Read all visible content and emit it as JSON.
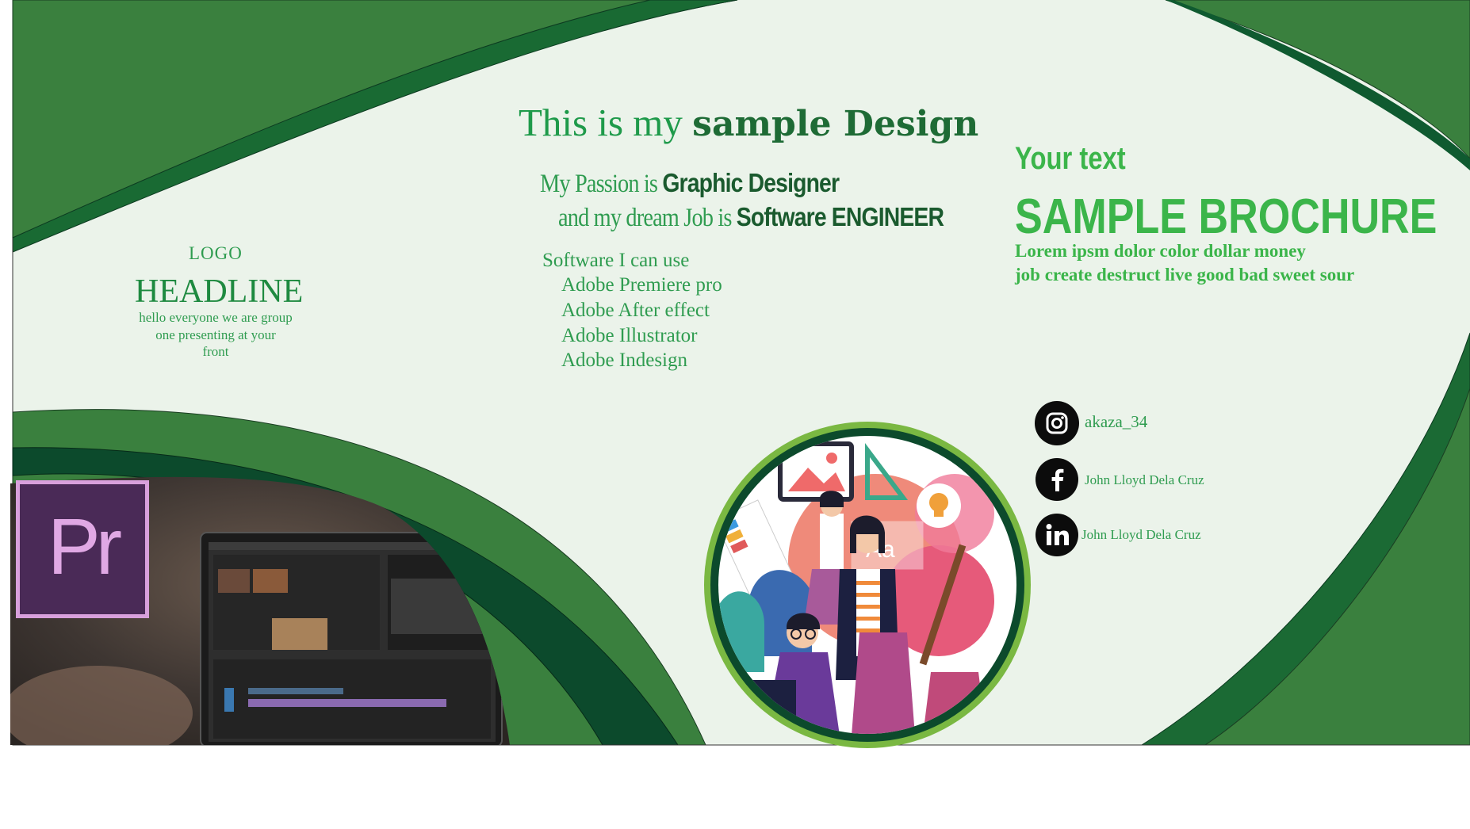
{
  "title": {
    "light": "This is my ",
    "bold": "sample Design"
  },
  "passion": {
    "line1_light": "My Passion is ",
    "line1_bold": "Graphic Designer",
    "line2_light": "and my dream Job is ",
    "line2_bold": "Software ENGINEER"
  },
  "software": {
    "heading": "Software I can use",
    "items": [
      "Adobe Premiere pro",
      "Adobe After effect",
      "Adobe Illustrator",
      "Adobe Indesign"
    ]
  },
  "left_panel": {
    "logo": "LOGO",
    "headline": "HEADLINE",
    "body_lines": [
      "hello everyone we are group",
      "one presenting at your",
      "front"
    ]
  },
  "right_panel": {
    "your_text": "Your text",
    "brochure": "SAMPLE BROCHURE",
    "lorem_lines": [
      "Lorem ipsm dolor color dollar money",
      "job create destruct live good bad sweet sour"
    ]
  },
  "social": [
    {
      "icon": "instagram-icon",
      "label": "akaza_34"
    },
    {
      "icon": "facebook-icon",
      "label": "John Lloyd Dela Cruz"
    },
    {
      "icon": "linkedin-icon",
      "label": "John Lloyd Dela Cruz"
    }
  ],
  "premiere_logo": "Pr",
  "illustration_text": "Aa",
  "colors": {
    "background": "#ebf3ea",
    "green_mid": "#3a803e",
    "green_dark": "#1b6a34",
    "green_darker": "#0c4a2c",
    "accent_light": "#3bb54a",
    "text_green": "#2f9c50"
  }
}
